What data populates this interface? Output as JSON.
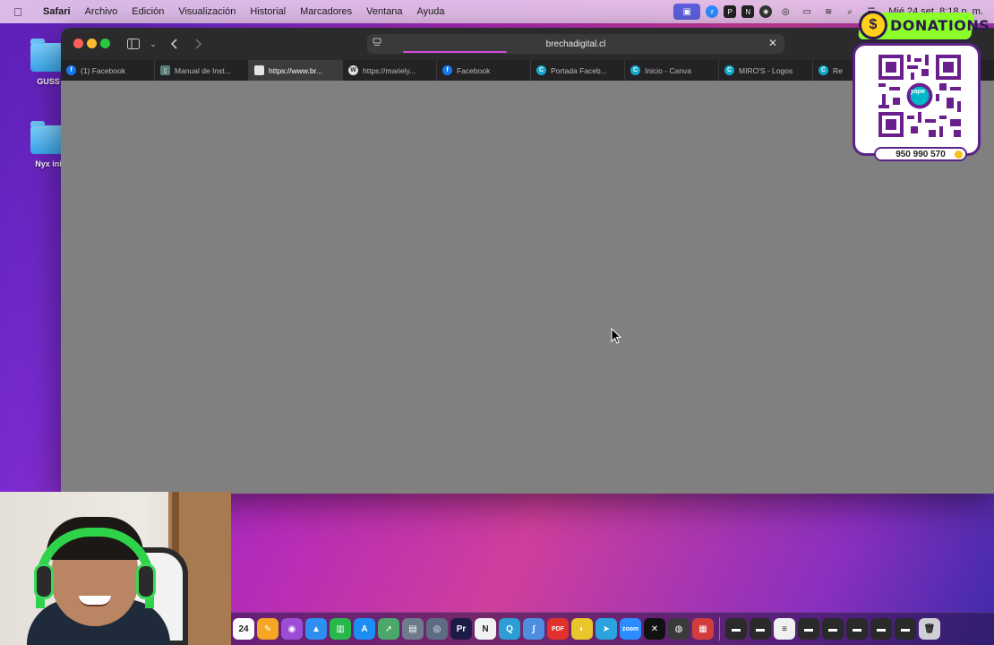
{
  "menubar": {
    "apple_icon": "apple-logo-icon",
    "app_name": "Safari",
    "menus": [
      "Archivo",
      "Edición",
      "Visualización",
      "Historial",
      "Marcadores",
      "Ventana",
      "Ayuda"
    ],
    "clock": "Mié 24 set. 8:18 p. m."
  },
  "desktop": {
    "icons": [
      {
        "label": "GUSS"
      },
      {
        "label": "Nyx ini"
      }
    ]
  },
  "safari": {
    "address": {
      "url": "brechadigital.cl",
      "clear_icon": "close-icon",
      "loading_color": "#d04bd9"
    },
    "tabs": [
      {
        "label": "(1) Facebook",
        "icon": "facebook-icon"
      },
      {
        "label": "Manual de Inst...",
        "icon": "document-icon"
      },
      {
        "label": "https://www.br...",
        "icon": "site-icon",
        "active": true
      },
      {
        "label": "https://mariely...",
        "icon": "wordpress-icon"
      },
      {
        "label": "Facebook",
        "icon": "facebook-icon"
      },
      {
        "label": "Portada Faceb...",
        "icon": "canva-icon"
      },
      {
        "label": "Inicio - Canva",
        "icon": "canva-icon"
      },
      {
        "label": "MIRO'S - Logos",
        "icon": "canva-icon"
      },
      {
        "label": "Re",
        "icon": "canva-icon"
      }
    ]
  },
  "donation": {
    "title": "DONATIONS",
    "qr_label": "yape",
    "phone": "950 990 570",
    "accent": "#8cff2a",
    "frame_color": "#5b2386"
  },
  "dock": {
    "calendar_day": "24",
    "icons": [
      {
        "name": "calendar-icon",
        "color": "#ffffff",
        "text": "24"
      },
      {
        "name": "pages-icon",
        "color": "#f5a623",
        "text": "✎"
      },
      {
        "name": "podcasts-icon",
        "color": "#9b4dd8",
        "text": "◉"
      },
      {
        "name": "keynote-icon",
        "color": "#2f8ff0",
        "text": "▲"
      },
      {
        "name": "numbers-icon",
        "color": "#27b84a",
        "text": "▥"
      },
      {
        "name": "app-store-icon",
        "color": "#1c8ef3",
        "text": "A"
      },
      {
        "name": "maps-icon",
        "color": "#4aa86b",
        "text": "➚"
      },
      {
        "name": "preview-icon",
        "color": "#6d7b8c",
        "text": "▤"
      },
      {
        "name": "safari-icon",
        "color": "#5d6c82",
        "text": "◎"
      },
      {
        "name": "premiere-icon",
        "color": "#1c1b45",
        "text": "Pr"
      },
      {
        "name": "notion-icon",
        "color": "#f2f2f2",
        "text": "N"
      },
      {
        "name": "quicktime-icon",
        "color": "#2c9ed4",
        "text": "Q"
      },
      {
        "name": "script-editor-icon",
        "color": "#4d8ee0",
        "text": "∫"
      },
      {
        "name": "pdf-icon",
        "color": "#e0312b",
        "text": "PDF"
      },
      {
        "name": "chrome-icon",
        "color": "#e9c62a",
        "text": "◐"
      },
      {
        "name": "telegram-icon",
        "color": "#2aa3df",
        "text": "➤"
      },
      {
        "name": "zoom-icon",
        "color": "#2d8cff",
        "text": "zoom"
      },
      {
        "name": "capcut-icon",
        "color": "#111111",
        "text": "✕"
      },
      {
        "name": "obs-icon",
        "color": "#3a3a3a",
        "text": "◍"
      },
      {
        "name": "photo-booth-icon",
        "color": "#d23c3c",
        "text": "▦"
      },
      {
        "name": "window-1-icon",
        "color": "#2a2a2a",
        "text": "▬"
      },
      {
        "name": "window-2-icon",
        "color": "#2a2a2a",
        "text": "▬"
      },
      {
        "name": "window-3-icon",
        "color": "#f0f0f0",
        "text": "≡"
      },
      {
        "name": "window-4-icon",
        "color": "#2a2a2a",
        "text": "▬"
      },
      {
        "name": "window-5-icon",
        "color": "#2a2a2a",
        "text": "▬"
      },
      {
        "name": "window-6-icon",
        "color": "#2a2a2a",
        "text": "▬"
      },
      {
        "name": "window-7-icon",
        "color": "#2a2a2a",
        "text": "▬"
      },
      {
        "name": "window-8-icon",
        "color": "#2a2a2a",
        "text": "▬"
      },
      {
        "name": "trash-icon",
        "color": "#cfcfd6",
        "text": "🗑"
      }
    ]
  }
}
